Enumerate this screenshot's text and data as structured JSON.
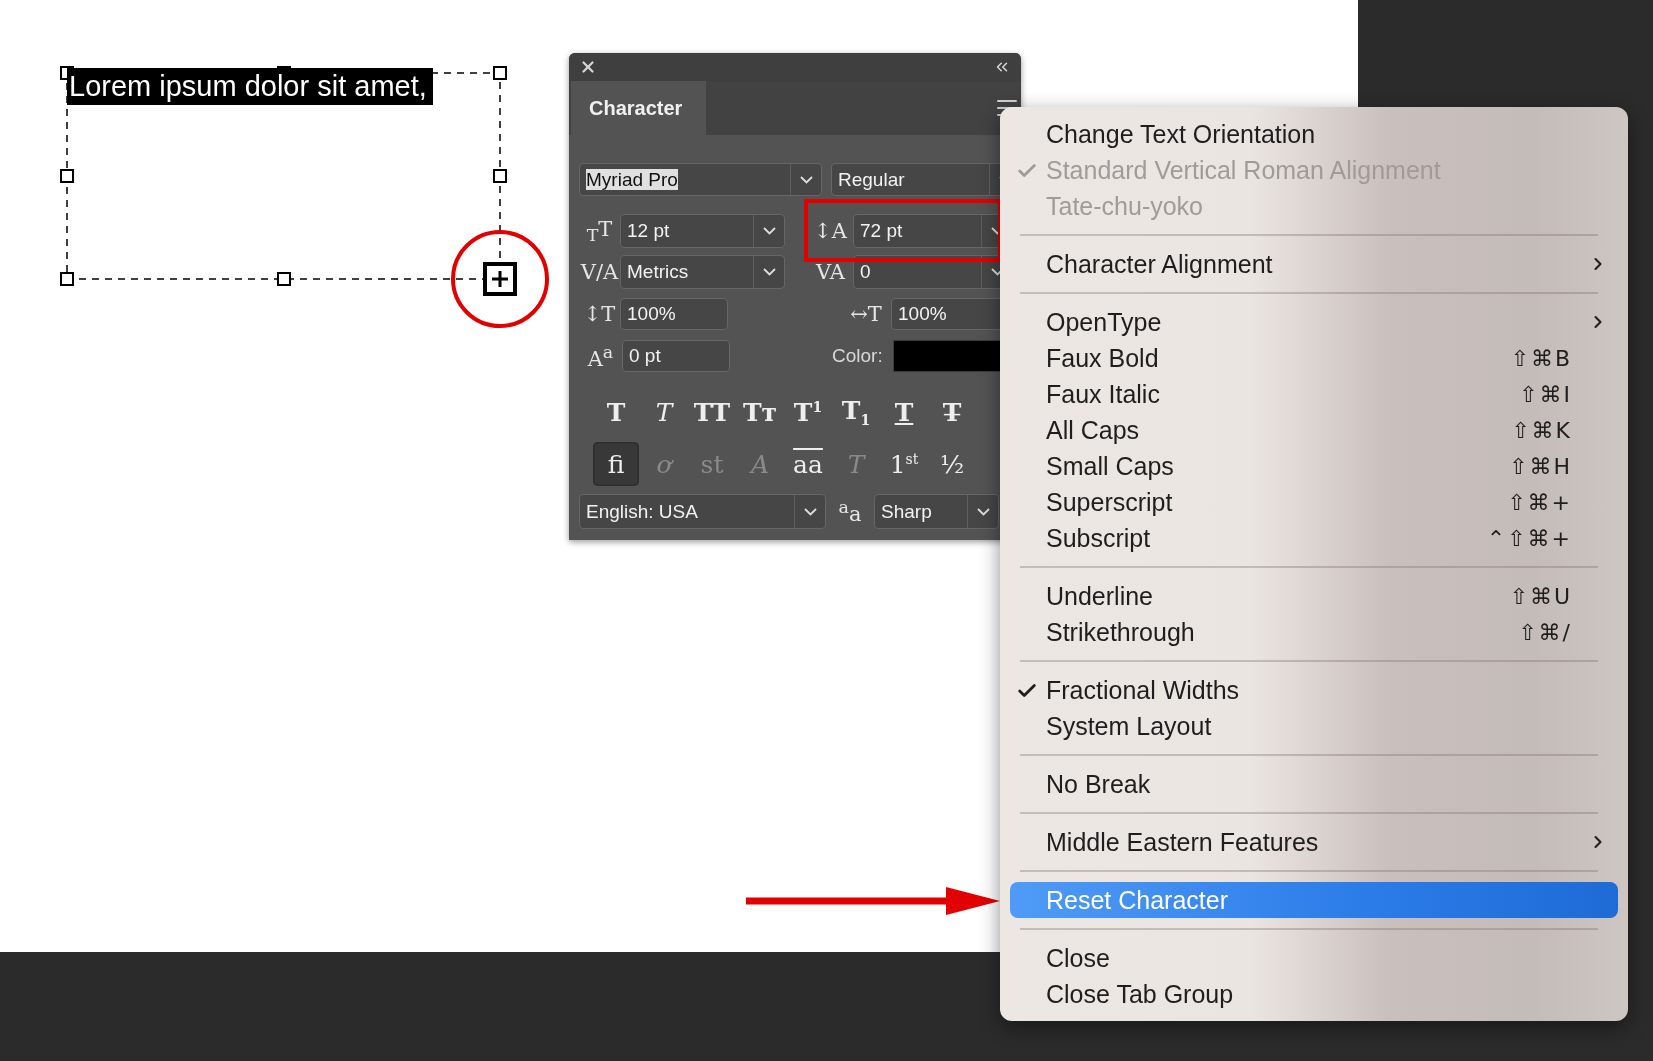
{
  "canvas": {
    "text": {
      "value": "Lorem ipsum dolor sit amet,",
      "selected": true
    }
  },
  "panel": {
    "tab": {
      "label": "Character",
      "selected": true
    },
    "font_family": {
      "value": "Myriad Pro",
      "text_selected": true
    },
    "font_style": {
      "value": "Regular"
    },
    "size": {
      "icon": "$_{T}$T",
      "value": "12 pt"
    },
    "leading": {
      "icon": "↕A",
      "value": "72 pt"
    },
    "kerning": {
      "icon": "V/A",
      "value": "Metrics"
    },
    "tracking": {
      "icon": "VA",
      "value": "0"
    },
    "vertical_scale": {
      "icon": "↕T",
      "value": "100%"
    },
    "horizontal_scale": {
      "icon": "↔T",
      "value": "100%"
    },
    "baseline_shift": {
      "icon": "A$^{a}$",
      "value": "0 pt"
    },
    "color": {
      "label": "Color:"
    },
    "type_styles": [
      {
        "kind": "bold",
        "glyph": "T",
        "selected": false
      },
      {
        "kind": "italic",
        "glyph": "T",
        "selected": false
      },
      {
        "kind": "all_caps",
        "glyph": "TT",
        "selected": false
      },
      {
        "kind": "small_caps",
        "glyph": "Tᴛ",
        "selected": false
      },
      {
        "kind": "superscript",
        "glyph": "T$^{1}$",
        "selected": false
      },
      {
        "kind": "subscript",
        "glyph": "T$_{1}$",
        "selected": false
      },
      {
        "kind": "underline",
        "glyph": "T",
        "selected": false
      },
      {
        "kind": "strikethrough",
        "glyph": "T̶",
        "selected": false
      }
    ],
    "opentype": [
      {
        "kind": "ligature",
        "glyph": "fi",
        "selected": true,
        "disabled": false
      },
      {
        "kind": "swash",
        "glyph": "ơ",
        "selected": false,
        "disabled": true
      },
      {
        "kind": "ligature",
        "glyph": "st",
        "selected": false,
        "disabled": true
      },
      {
        "kind": "swash",
        "glyph": "A",
        "selected": false,
        "disabled": true
      },
      {
        "kind": "alternate",
        "glyph": "aa",
        "selected": false,
        "disabled": false
      },
      {
        "kind": "titling",
        "glyph": "T",
        "selected": false,
        "disabled": true
      },
      {
        "kind": "plain",
        "glyph": "1$^{st}$",
        "selected": false,
        "disabled": false
      },
      {
        "kind": "plain",
        "glyph": "½",
        "selected": false,
        "disabled": false
      }
    ],
    "language": {
      "value": "English: USA"
    },
    "antialias": {
      "icon": "$^{a}$a",
      "value": "Sharp"
    }
  },
  "menu": {
    "items": [
      {
        "kind": "item",
        "label": "Change Text Orientation",
        "checked": false,
        "disabled": false,
        "selected": false,
        "submenu": false
      },
      {
        "kind": "item",
        "label": "Standard Vertical Roman Alignment",
        "checked": true,
        "disabled": true,
        "selected": false,
        "submenu": false
      },
      {
        "kind": "item",
        "label": "Tate-chu-yoko",
        "checked": false,
        "disabled": true,
        "selected": false,
        "submenu": false
      },
      {
        "kind": "separator"
      },
      {
        "kind": "item",
        "label": "Character Alignment",
        "checked": false,
        "disabled": false,
        "selected": false,
        "submenu": true
      },
      {
        "kind": "separator"
      },
      {
        "kind": "item",
        "label": "OpenType",
        "checked": false,
        "disabled": false,
        "selected": false,
        "submenu": true
      },
      {
        "kind": "item",
        "label": "Faux Bold",
        "shortcut": "⇧⌘B",
        "checked": false,
        "disabled": false,
        "selected": false,
        "submenu": false
      },
      {
        "kind": "item",
        "label": "Faux Italic",
        "shortcut": "⇧⌘I",
        "checked": false,
        "disabled": false,
        "selected": false,
        "submenu": false
      },
      {
        "kind": "item",
        "label": "All Caps",
        "shortcut": "⇧⌘K",
        "checked": false,
        "disabled": false,
        "selected": false,
        "submenu": false
      },
      {
        "kind": "item",
        "label": "Small Caps",
        "shortcut": "⇧⌘H",
        "checked": false,
        "disabled": false,
        "selected": false,
        "submenu": false
      },
      {
        "kind": "item",
        "label": "Superscript",
        "shortcut": "⇧⌘+",
        "checked": false,
        "disabled": false,
        "selected": false,
        "submenu": false
      },
      {
        "kind": "item",
        "label": "Subscript",
        "shortcut": "⌃⇧⌘+",
        "checked": false,
        "disabled": false,
        "selected": false,
        "submenu": false
      },
      {
        "kind": "separator"
      },
      {
        "kind": "item",
        "label": "Underline",
        "shortcut": "⇧⌘U",
        "checked": false,
        "disabled": false,
        "selected": false,
        "submenu": false
      },
      {
        "kind": "item",
        "label": "Strikethrough",
        "shortcut": "⇧⌘/",
        "checked": false,
        "disabled": false,
        "selected": false,
        "submenu": false
      },
      {
        "kind": "separator"
      },
      {
        "kind": "item",
        "label": "Fractional Widths",
        "checked": true,
        "disabled": false,
        "selected": false,
        "submenu": false
      },
      {
        "kind": "item",
        "label": "System Layout",
        "checked": false,
        "disabled": false,
        "selected": false,
        "submenu": false
      },
      {
        "kind": "separator"
      },
      {
        "kind": "item",
        "label": "No Break",
        "checked": false,
        "disabled": false,
        "selected": false,
        "submenu": false
      },
      {
        "kind": "separator"
      },
      {
        "kind": "item",
        "label": "Middle Eastern Features",
        "checked": false,
        "disabled": false,
        "selected": false,
        "submenu": true
      },
      {
        "kind": "separator"
      },
      {
        "kind": "item",
        "label": "Reset Character",
        "checked": false,
        "disabled": false,
        "selected": true,
        "submenu": false
      },
      {
        "kind": "separator"
      },
      {
        "kind": "item",
        "label": "Close",
        "checked": false,
        "disabled": false,
        "selected": false,
        "submenu": false
      },
      {
        "kind": "item",
        "label": "Close Tab Group",
        "checked": false,
        "disabled": false,
        "selected": false,
        "submenu": false
      }
    ]
  }
}
